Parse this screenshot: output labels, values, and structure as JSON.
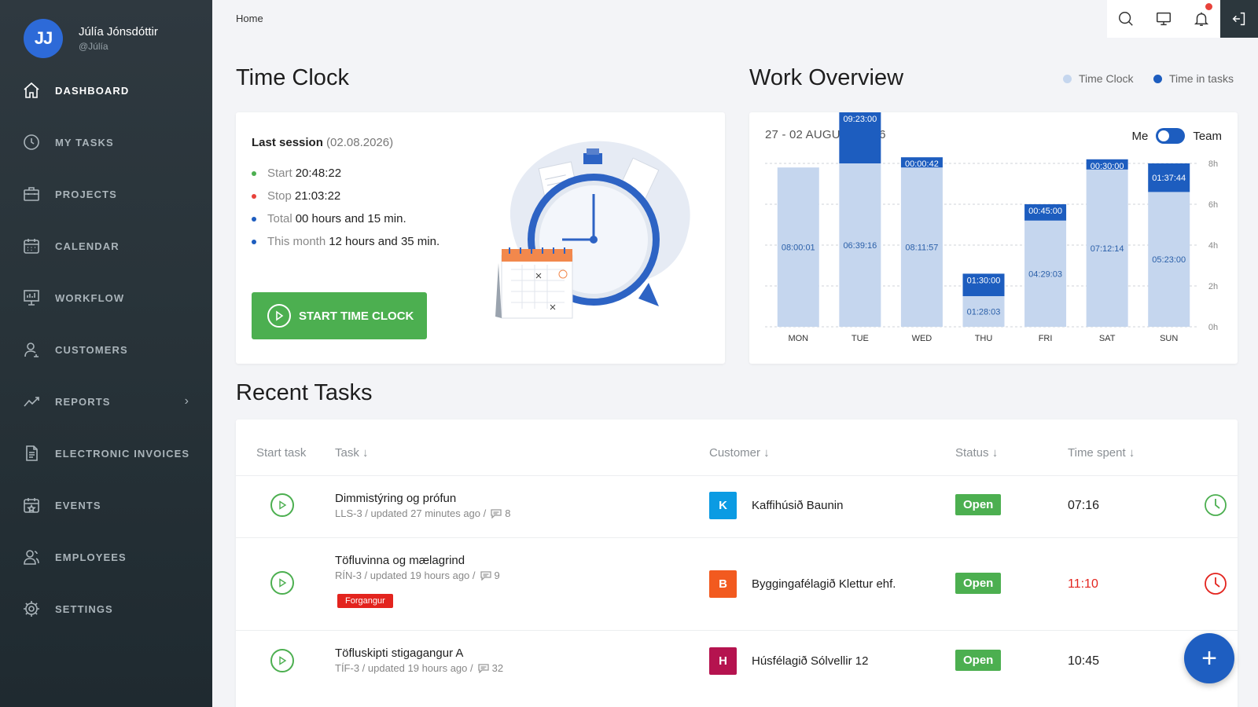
{
  "user": {
    "initials": "JJ",
    "name": "Júlía Jónsdóttir",
    "handle": "@Júlía"
  },
  "nav": [
    {
      "label": "DASHBOARD",
      "icon": "home-icon"
    },
    {
      "label": "MY TASKS",
      "icon": "clock-icon"
    },
    {
      "label": "PROJECTS",
      "icon": "briefcase-icon"
    },
    {
      "label": "CALENDAR",
      "icon": "calendar-icon"
    },
    {
      "label": "WORKFLOW",
      "icon": "workflow-icon"
    },
    {
      "label": "CUSTOMERS",
      "icon": "user-icon"
    },
    {
      "label": "REPORTS",
      "icon": "chart-line-icon"
    },
    {
      "label": "ELECTRONIC INVOICES",
      "icon": "document-icon"
    },
    {
      "label": "EVENTS",
      "icon": "calendar-star-icon"
    },
    {
      "label": "EMPLOYEES",
      "icon": "users-icon"
    },
    {
      "label": "SETTINGS",
      "icon": "gear-icon"
    }
  ],
  "breadcrumb": "Home",
  "time_clock": {
    "title": "Time Clock",
    "last_session_label": "Last session",
    "last_session_date": "(02.08.2026)",
    "start_label": "Start",
    "start_value": "20:48:22",
    "stop_label": "Stop",
    "stop_value": "21:03:22",
    "total_label": "Total",
    "total_value": "00 hours and 15 min.",
    "month_label": "This month",
    "month_value": "12 hours and 35 min.",
    "button_label": "START TIME CLOCK"
  },
  "work_overview": {
    "title": "Work Overview",
    "legend_time_clock": "Time Clock",
    "legend_time_tasks": "Time in tasks",
    "range": "27 - 02 AUGUST 2026",
    "toggle_me": "Me",
    "toggle_team": "Team"
  },
  "colors": {
    "accent": "#1d5dbf",
    "light_bar": "#c5d6ee",
    "green": "#4caf50",
    "red": "#e3241e"
  },
  "chart_data": {
    "type": "bar",
    "categories": [
      "MON",
      "TUE",
      "WED",
      "THU",
      "FRI",
      "SAT",
      "SUN"
    ],
    "series": [
      {
        "name": "Time Clock",
        "values": [
          7.8,
          8.0,
          7.8,
          1.5,
          5.2,
          7.7,
          6.6
        ],
        "labels": [
          "08:00:01",
          "06:39:16",
          "08:11:57",
          "01:28:03",
          "04:29:03",
          "07:12:14",
          "05:23:00"
        ]
      },
      {
        "name": "Time in tasks",
        "values": [
          0,
          4.4,
          0.5,
          1.1,
          0.8,
          0.5,
          1.4
        ],
        "labels": [
          "",
          "09:23:00",
          "00:00:42",
          "01:30:00",
          "00:45:00",
          "00:30:00",
          "01:37:44"
        ]
      }
    ],
    "yticks": [
      "0h",
      "2h",
      "4h",
      "6h",
      "8h"
    ],
    "ylim": [
      0,
      8
    ],
    "grid": true
  },
  "recent_tasks": {
    "title": "Recent Tasks",
    "headers": {
      "start": "Start task",
      "task": "Task ↓",
      "customer": "Customer ↓",
      "status": "Status ↓",
      "spent": "Time spent ↓"
    },
    "rows": [
      {
        "title": "Dimmistýring og prófun",
        "meta": "LLS-3 / updated 27 minutes ago /",
        "comments": "8",
        "tag": "",
        "cust_initial": "K",
        "cust_color": "#0b9be3",
        "customer": "Kaffihúsið Baunin",
        "status": "Open",
        "spent": "07:16",
        "overdue": false
      },
      {
        "title": "Töfluvinna og mælagrind",
        "meta": "RÍN-3 / updated 19 hours ago /",
        "comments": "9",
        "tag": "Forgangur",
        "cust_initial": "B",
        "cust_color": "#f25a1f",
        "customer": "Byggingafélagið Klettur ehf.",
        "status": "Open",
        "spent": "11:10",
        "overdue": true
      },
      {
        "title": "Töfluskipti stigagangur A",
        "meta": "TÍF-3 / updated 19 hours ago /",
        "comments": "32",
        "tag": "",
        "cust_initial": "H",
        "cust_color": "#b5134f",
        "customer": "Húsfélagið Sólvellir 12",
        "status": "Open",
        "spent": "10:45",
        "overdue": false
      }
    ]
  },
  "fab_label": "+"
}
